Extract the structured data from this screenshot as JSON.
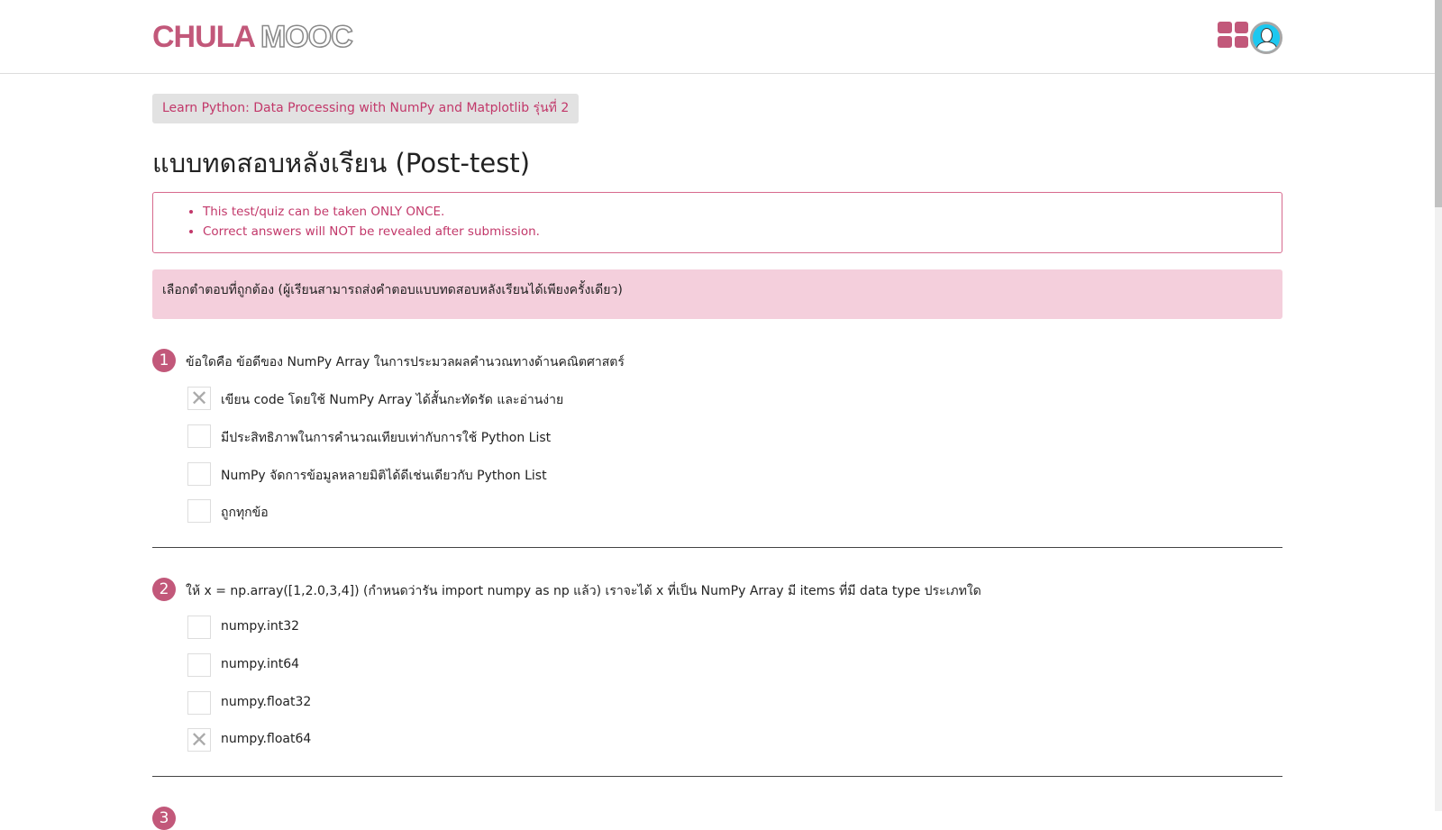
{
  "header": {
    "logo_part1": "CHULA",
    "logo_part2": "MOOC",
    "apps_icon": "grid-icon",
    "avatar_icon": "user-avatar"
  },
  "breadcrumb": "Learn Python: Data Processing with NumPy and Matplotlib รุ่นที่ 2",
  "title": "แบบทดสอบหลังเรียน (Post-test)",
  "notices": [
    "This test/quiz can be taken ONLY ONCE.",
    "Correct answers will NOT be revealed after submission."
  ],
  "instruction": "เลือกตำตอบที่ถูกต้อง (ผู้เรียนสามารถส่งคำตอบแบบทดสอบหลังเรียนได้เพียงครั้งเดียว)",
  "colors": {
    "accent": "#c2587a",
    "instruction_bg": "#f4cfdc"
  },
  "questions": [
    {
      "number": "1",
      "text": "ข้อใดคือ ข้อดีของ NumPy Array ในการประมวลผลคำนวณทางด้านคณิตศาสตร์",
      "options": [
        {
          "label": "เขียน code โดยใช้ NumPy Array ได้สั้นกะทัดรัด และอ่านง่าย",
          "mark": "✕"
        },
        {
          "label": "มีประสิทธิภาพในการคำนวณเทียบเท่ากับการใช้ Python List",
          "mark": ""
        },
        {
          "label": "NumPy จัดการข้อมูลหลายมิติได้ดีเช่นเดียวกับ Python List",
          "mark": ""
        },
        {
          "label": "ถูกทุกข้อ",
          "mark": ""
        }
      ]
    },
    {
      "number": "2",
      "text": "ให้ x = np.array([1,2.0,3,4]) (กำหนดว่ารัน import numpy as np แล้ว) เราจะได้ x ที่เป็น NumPy Array มี items ที่มี data type ประเภทใด",
      "options": [
        {
          "label": "numpy.int32",
          "mark": ""
        },
        {
          "label": "numpy.int64",
          "mark": ""
        },
        {
          "label": "numpy.float32",
          "mark": ""
        },
        {
          "label": "numpy.float64",
          "mark": "✕"
        }
      ]
    },
    {
      "number": "3"
    }
  ]
}
